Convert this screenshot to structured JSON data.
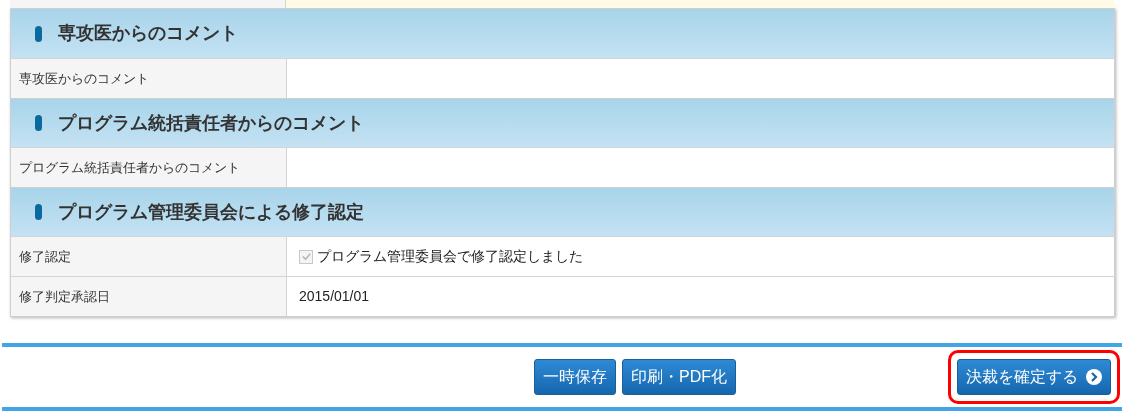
{
  "sections": [
    {
      "title": "専攻医からのコメント",
      "rows": [
        {
          "kind": "text",
          "label": "専攻医からのコメント"
        }
      ]
    },
    {
      "title": "プログラム統括責任者からのコメント",
      "rows": [
        {
          "kind": "text",
          "label": "プログラム統括責任者からのコメント"
        }
      ]
    },
    {
      "title": "プログラム管理委員会による修了認定",
      "rows": [
        {
          "kind": "checkbox",
          "label": "修了認定",
          "option": "プログラム管理委員会で修了認定しました",
          "checked": true,
          "disabled": true
        },
        {
          "kind": "text",
          "label": "修了判定承認日",
          "value": "2015/01/01"
        }
      ]
    }
  ],
  "buttons": [
    {
      "label": "一時保存"
    },
    {
      "label": "印刷・PDF化"
    }
  ],
  "confirm": {
    "label": "決裁を確定する",
    "highlighted": true
  }
}
